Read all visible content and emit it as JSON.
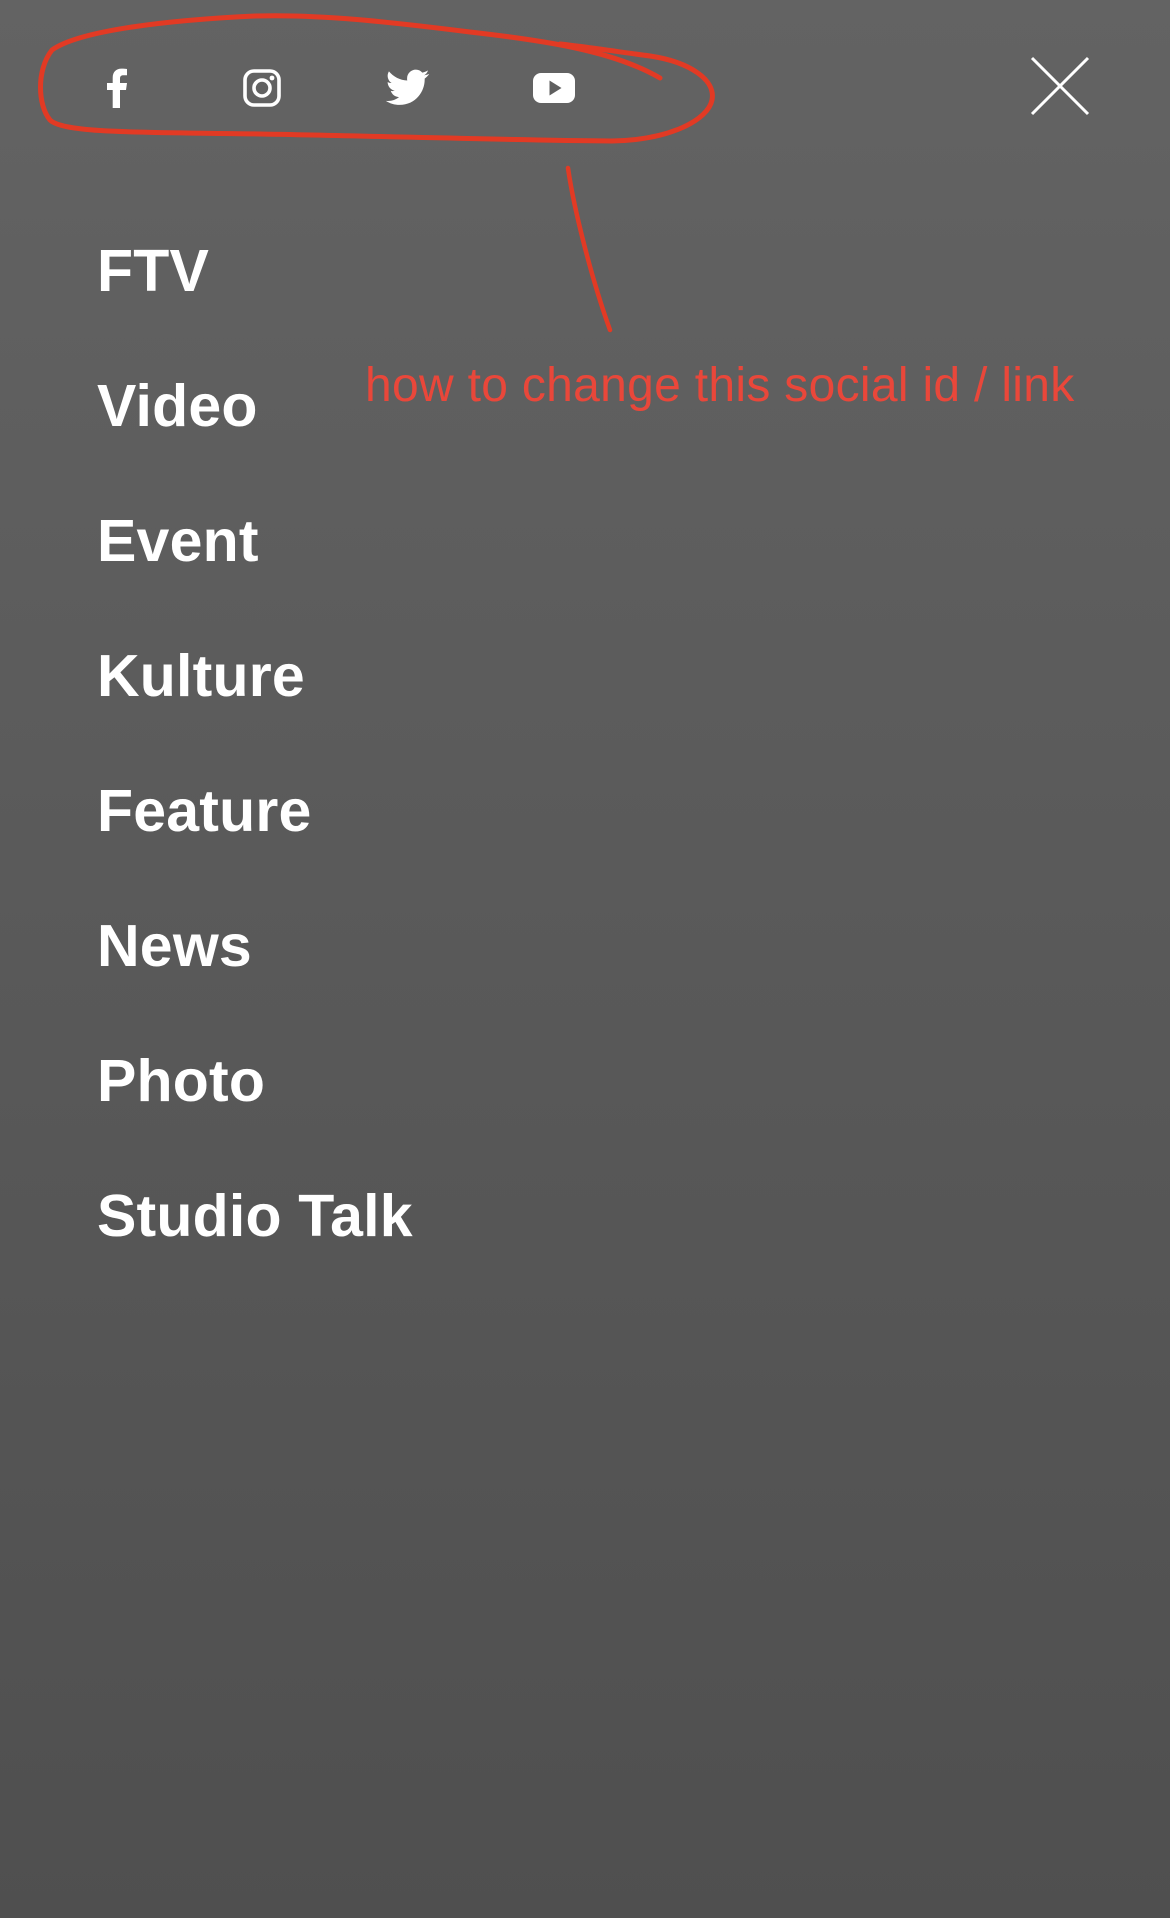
{
  "social": {
    "links": [
      {
        "name": "facebook",
        "icon": "facebook-icon"
      },
      {
        "name": "instagram",
        "icon": "instagram-icon"
      },
      {
        "name": "twitter",
        "icon": "twitter-icon"
      },
      {
        "name": "youtube",
        "icon": "youtube-icon"
      }
    ],
    "icon_color": "#ffffff"
  },
  "close": {
    "icon": "close-icon"
  },
  "menu": {
    "items": [
      {
        "label": "FTV"
      },
      {
        "label": "Video"
      },
      {
        "label": "Event"
      },
      {
        "label": "Kulture"
      },
      {
        "label": "Feature"
      },
      {
        "label": "News"
      },
      {
        "label": "Photo"
      },
      {
        "label": "Studio Talk"
      }
    ]
  },
  "annotation": {
    "text": "how to change this social id / link",
    "color": "#e9473a"
  },
  "theme": {
    "background": "#5a5a5a",
    "text_color": "#ffffff"
  }
}
